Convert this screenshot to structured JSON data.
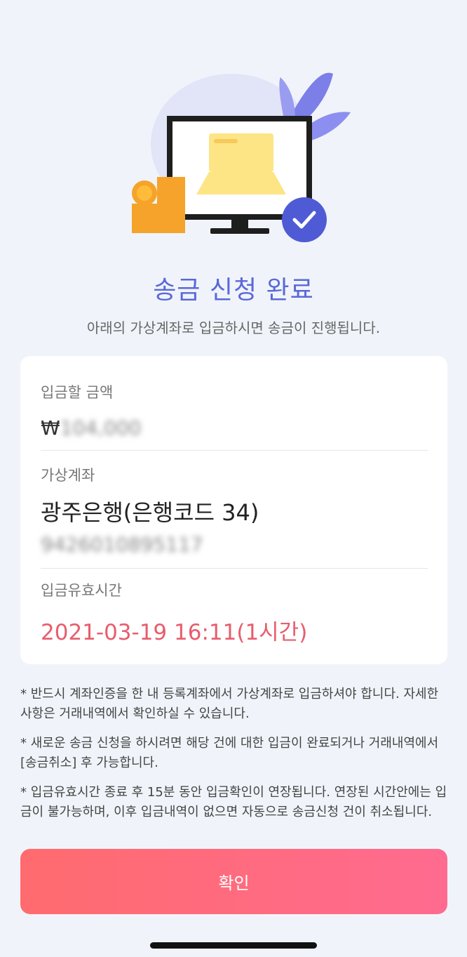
{
  "header": {
    "title": "송금 신청 완료",
    "subtitle": "아래의 가상계좌로 입금하시면 송금이 진행됩니다."
  },
  "deposit": {
    "amount_label": "입금할 금액",
    "currency": "₩",
    "amount": "104,000"
  },
  "account": {
    "label": "가상계좌",
    "bank": "광주은행(은행코드 34)",
    "number": "9426010895117"
  },
  "validity": {
    "label": "입금유효시간",
    "value": "2021-03-19 16:11(1시간)"
  },
  "notes": [
    "* 반드시 계좌인증을 한 내 등록계좌에서 가상계좌로 입금하셔야 합니다. 자세한 사항은 거래내역에서 확인하실 수 있습니다.",
    "* 새로운 송금 신청을 하시려면 해당 건에 대한 입금이 완료되거나 거래내역에서 [송금취소] 후 가능합니다.",
    "* 입금유효시간 종료 후 15분 동안 입금확인이 연장됩니다. 연장된 시간안에는 입금이 불가능하며, 이후 입금내역이 없으면 자동으로 송금신청 건이 취소됩니다."
  ],
  "confirm_label": "확인",
  "colors": {
    "title": "#5a68d8",
    "expiry": "#e85d6c",
    "button_start": "#ff6b6e",
    "button_end": "#ff6b8f",
    "check_badge": "#4f5bd5"
  },
  "icons": [
    "monitor-illustration",
    "coin-stack-icon",
    "leaf-icon",
    "check-circle-icon"
  ]
}
